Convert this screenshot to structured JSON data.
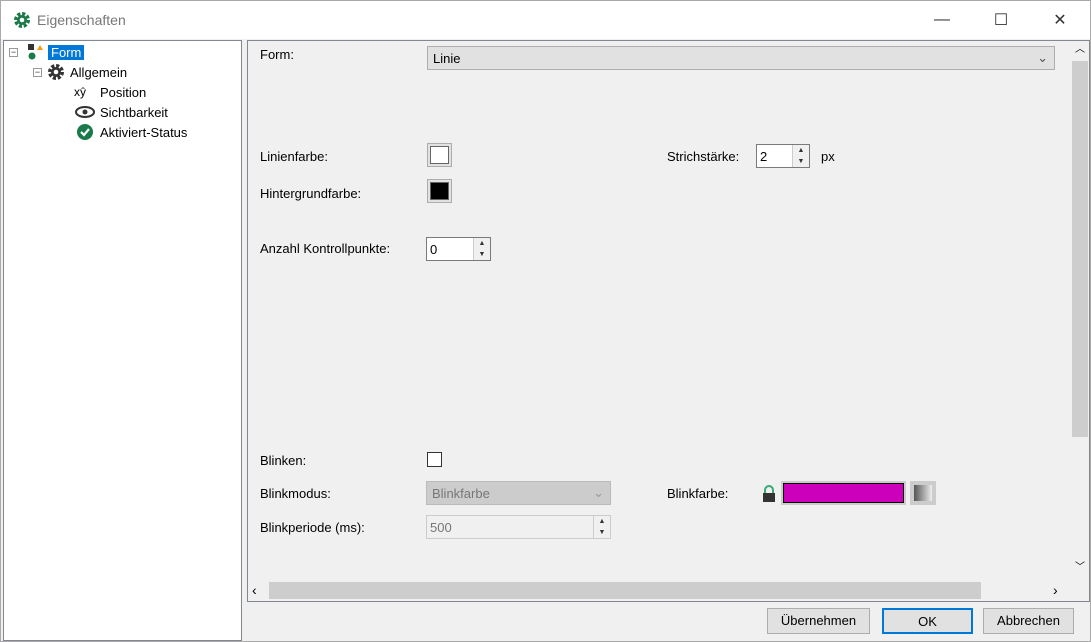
{
  "window": {
    "title": "Eigenschaften",
    "minimize": "—",
    "maximize": "☐",
    "close": "✕"
  },
  "tree": {
    "items": [
      {
        "label": "Form"
      },
      {
        "label": "Allgemein"
      },
      {
        "label": "Position"
      },
      {
        "label": "Sichtbarkeit"
      },
      {
        "label": "Aktiviert-Status"
      }
    ]
  },
  "form": {
    "form_label": "Form:",
    "form_value": "Linie",
    "linienfarbe_label": "Linienfarbe:",
    "linienfarbe_color": "#ffffff",
    "hintergrundfarbe_label": "Hintergrundfarbe:",
    "hintergrundfarbe_color": "#000000",
    "strichstaerke_label": "Strichstärke:",
    "strichstaerke_value": "2",
    "strichstaerke_unit": "px",
    "kontrollpunkte_label": "Anzahl Kontrollpunkte:",
    "kontrollpunkte_value": "0",
    "blinken_label": "Blinken:",
    "blinken_checked": false,
    "blinkmodus_label": "Blinkmodus:",
    "blinkmodus_value": "Blinkfarbe",
    "blinkfarbe_label": "Blinkfarbe:",
    "blinkfarbe_color": "#cc00bb",
    "blinkperiode_label": "Blinkperiode (ms):",
    "blinkperiode_value": "500"
  },
  "buttons": {
    "apply": "Übernehmen",
    "ok": "OK",
    "cancel": "Abbrechen"
  },
  "colors": {
    "accent": "#0078d7",
    "icon_green": "#1a7a4a"
  }
}
